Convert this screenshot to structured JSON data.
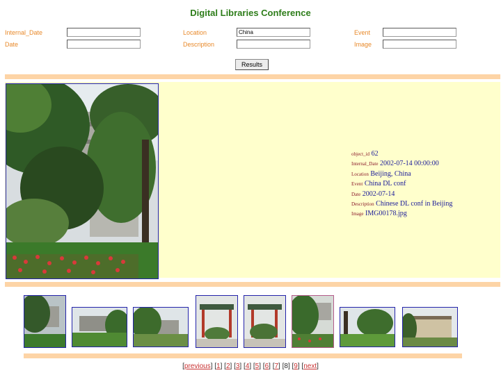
{
  "page_title": "Digital Libraries Conference",
  "form": {
    "internal_date_label": "Internal_Date",
    "internal_date_value": "",
    "location_label": "Location",
    "location_value": "China",
    "event_label": "Event",
    "event_value": "",
    "date_label": "Date",
    "date_value": "",
    "description_label": "Description",
    "description_value": "",
    "image_label": "Image",
    "image_value": "",
    "submit_label": "Results"
  },
  "record": {
    "object_id_label": "object_id",
    "object_id": "62",
    "internal_date_label": "Internal_Date",
    "internal_date": "2002-07-14 00:00:00",
    "location_label": "Location",
    "location": "Beijing, China",
    "event_label": "Event",
    "event": "China DL conf",
    "date_label": "Date",
    "date": "2002-07-14",
    "description_label": "Description",
    "description": "Chinese DL conf in Beijing",
    "image_label": "Image",
    "image": "IMG00178.jpg"
  },
  "pagination": {
    "previous": "previous",
    "pages": [
      "1",
      "2",
      "3",
      "4",
      "5",
      "6",
      "7",
      "8",
      "9"
    ],
    "current": "8",
    "next": "next"
  },
  "colors": {
    "title": "#2e7d1a",
    "label": "#e8892a",
    "panel": "#ffffcc",
    "bar": "#fdd4a6",
    "link": "#c83232",
    "meta_value": "#1a1a99",
    "thumb_border": "#2222aa"
  }
}
